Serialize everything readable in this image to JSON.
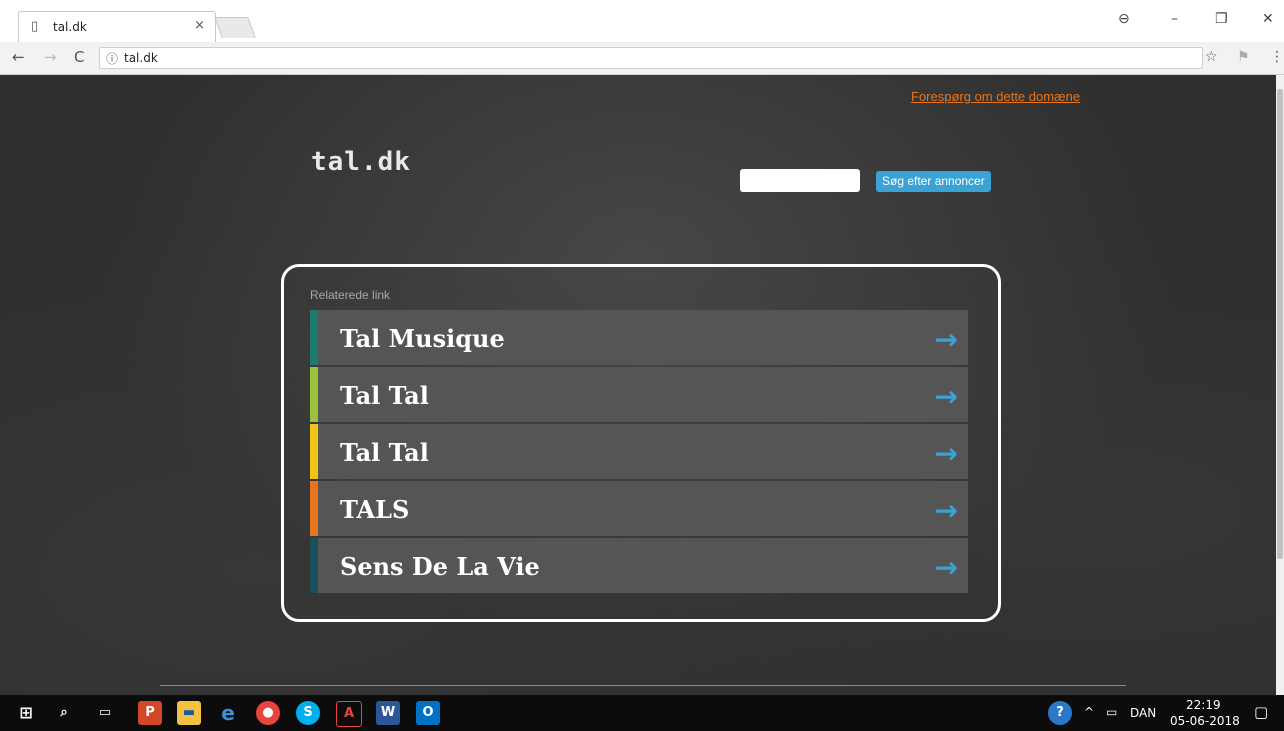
{
  "browser": {
    "tab": {
      "favicon": "page-icon",
      "title": "tal.dk",
      "close": "×"
    },
    "window_controls": {
      "account": "⊖",
      "minimize": "–",
      "restore": "❐",
      "close": "✕"
    },
    "nav": {
      "back": "←",
      "forward": "→",
      "reload": "C"
    },
    "address": {
      "info_icon": "ⓘ",
      "url": "tal.dk"
    },
    "toolbar_icons": {
      "star": "☆",
      "extension": "⚑",
      "menu": "⋮"
    }
  },
  "page": {
    "inquire_link": "Forespørg om dette domæne",
    "logo": "tal.dk",
    "search": {
      "placeholder": "",
      "button": "Søg efter annoncer"
    },
    "related": {
      "heading": "Relaterede link",
      "items": [
        {
          "label": "Tal Musique",
          "color": "#1f7a6e",
          "arrow": "→"
        },
        {
          "label": "Tal Tal",
          "color": "#9cc23c",
          "arrow": "→"
        },
        {
          "label": "Tal Tal",
          "color": "#f0c419",
          "arrow": "→"
        },
        {
          "label": "TALS",
          "color": "#e8741e",
          "arrow": "→"
        },
        {
          "label": "Sens De La Vie",
          "color": "#1e4e5c",
          "arrow": "→"
        }
      ]
    },
    "accent_link_color": "#e8741e",
    "accent_button_color": "#3aa3d3"
  },
  "taskbar": {
    "apps": [
      "start-icon",
      "search-icon",
      "task-view-icon",
      "powerpoint-icon",
      "file-explorer-icon",
      "edge-icon",
      "chrome-icon",
      "skype-icon",
      "acrobat-icon",
      "word-icon",
      "outlook-icon"
    ],
    "tray": {
      "language": "DAN",
      "time": "22:19",
      "date": "05-06-2018",
      "chevron": "^"
    }
  }
}
